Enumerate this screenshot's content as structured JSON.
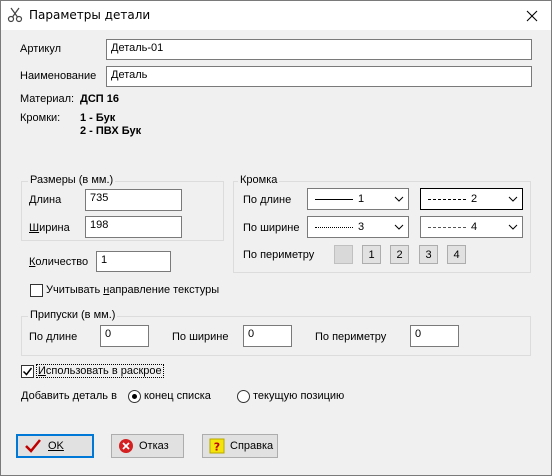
{
  "window": {
    "title": "Параметры детали"
  },
  "fields": {
    "article_label": "Артикул",
    "article_value": "Деталь-01",
    "name_label": "Наименование",
    "name_value": "Деталь",
    "material_label": "Материал:",
    "material_value": "ДСП 16",
    "edges_label": "Кромки:",
    "edges_list": [
      "1 - Бук",
      "2 - ПВХ Бук"
    ]
  },
  "sizes": {
    "group_title": "Размеры (в мм.)",
    "length_label": "Длина",
    "length_value": "735",
    "width_label": "Ширина",
    "width_value": "198"
  },
  "quantity": {
    "label": "Количество",
    "value": "1"
  },
  "texture": {
    "label": "Учитывать направление текстуры",
    "checked": false
  },
  "edge": {
    "group_title": "Кромка",
    "length_label": "По длине",
    "width_label": "По ширине",
    "perimeter_label": "По периметру",
    "length_combo1": "1",
    "length_combo2": "2",
    "width_combo1": "3",
    "width_combo2": "4",
    "perimeter_buttons": [
      "",
      "1",
      "2",
      "3",
      "4"
    ]
  },
  "allowances": {
    "group_title": "Припуски (в мм.)",
    "length_label": "По длине",
    "length_value": "0",
    "width_label": "По ширине",
    "width_value": "0",
    "perimeter_label": "По периметру",
    "perimeter_value": "0"
  },
  "use_in_cutting": {
    "label": "Использовать в раскрое",
    "checked": true
  },
  "add_to": {
    "label": "Добавить деталь в",
    "option_end": "конец списка",
    "option_current": "текущую позицию",
    "selected": "конец списка"
  },
  "buttons": {
    "ok": "OK",
    "cancel": "Отказ",
    "help": "Справка"
  }
}
